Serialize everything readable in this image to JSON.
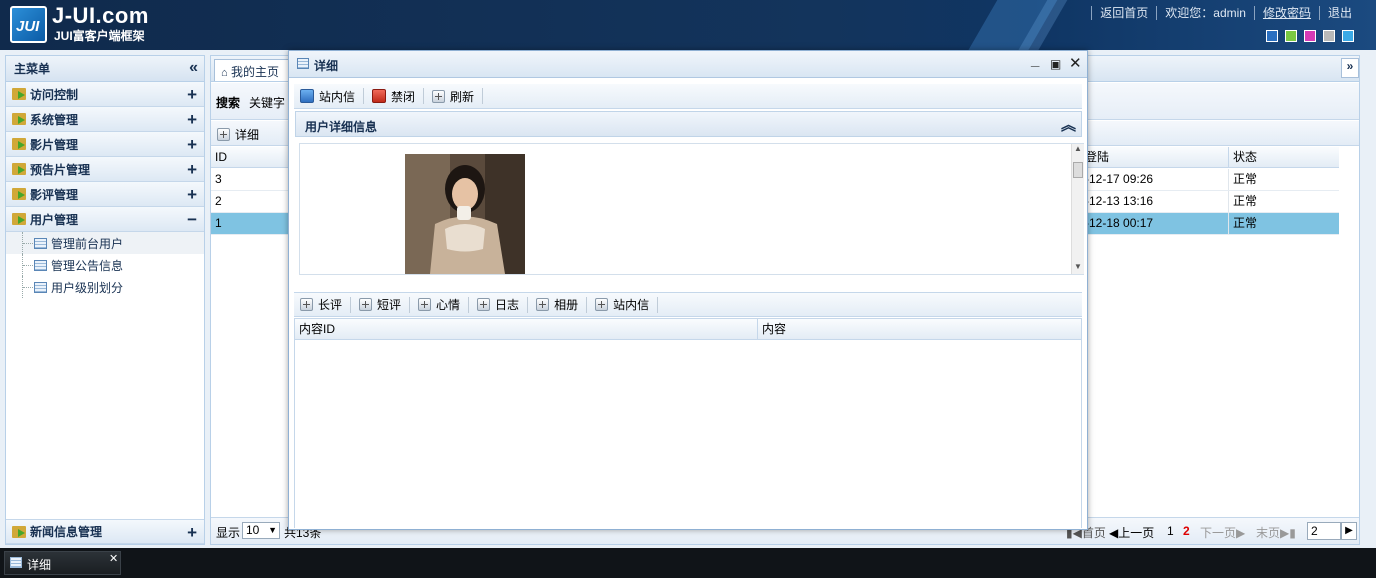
{
  "header": {
    "logo_mark": "JUI",
    "logo_text": "J-UI.com",
    "logo_sub": "JUI富客户端框架",
    "nav": [
      "返回首页",
      "欢迎您：admin",
      "修改密码",
      "退出"
    ],
    "theme_colors": [
      "#2a6fc0",
      "#7ac943",
      "#d63bb5",
      "#b9b9b9",
      "#3aa9e6"
    ]
  },
  "sidebar": {
    "title": "主菜单",
    "groups": [
      {
        "label": "访问控制",
        "state": "+"
      },
      {
        "label": "系统管理",
        "state": "+"
      },
      {
        "label": "影片管理",
        "state": "+"
      },
      {
        "label": "预告片管理",
        "state": "+"
      },
      {
        "label": "影评管理",
        "state": "+"
      },
      {
        "label": "用户管理",
        "state": "−"
      }
    ],
    "tree": [
      "管理前台用户",
      "管理公告信息",
      "用户级别划分"
    ],
    "bottom_group": {
      "label": "新闻信息管理",
      "state": "+"
    }
  },
  "main": {
    "home_tab": "我的主页",
    "search_label": "搜索",
    "keyword_label": "关键字",
    "detail_button": "详细",
    "columns": {
      "id": "ID",
      "last_login": "登陆",
      "status": "状态"
    },
    "rows": [
      {
        "id": "3",
        "last_login": "-12-17 09:26",
        "status": "正常"
      },
      {
        "id": "2",
        "last_login": "-12-13 13:16",
        "status": "正常"
      },
      {
        "id": "1",
        "last_login": "-12-18 00:17",
        "status": "正常"
      }
    ],
    "pager": {
      "show_label": "显示",
      "page_size": "10",
      "total_label": "共13条",
      "first": "首页",
      "prev": "上一页",
      "pages": [
        "1",
        "2"
      ],
      "current_page": "2",
      "next": "下一页",
      "last": "末页",
      "goto_value": "2"
    }
  },
  "dialog": {
    "title": "详细",
    "toolbar": [
      "站内信",
      "禁闭",
      "刷新"
    ],
    "panel_title": "用户详细信息",
    "tabs": [
      "长评",
      "短评",
      "心情",
      "日志",
      "相册",
      "站内信"
    ],
    "columns": [
      "内容ID",
      "内容"
    ]
  },
  "taskbar": {
    "item": "详细"
  }
}
